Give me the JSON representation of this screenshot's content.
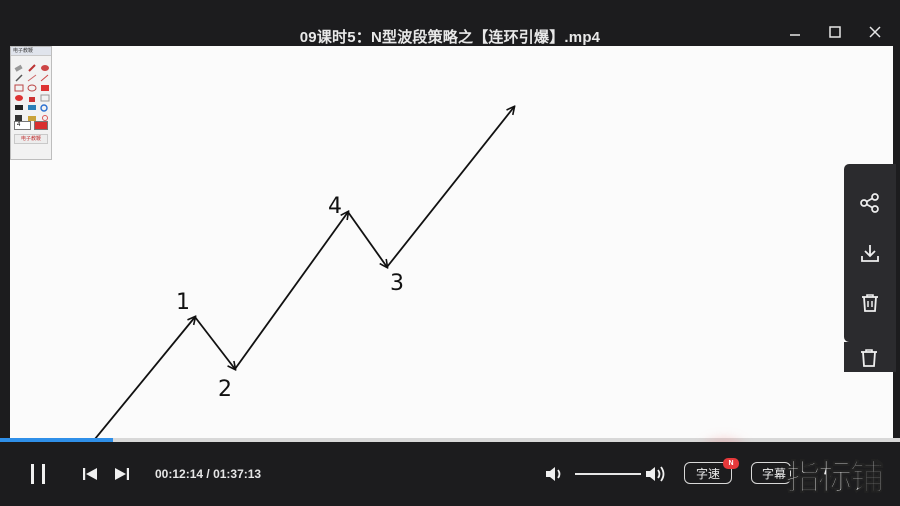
{
  "window": {
    "title": "09课时5：N型波段策略之【连环引爆】.mp4"
  },
  "drawing": {
    "labels": [
      "1",
      "2",
      "4",
      "3"
    ]
  },
  "palette": {
    "header": "电子教鞭",
    "size_value": "4",
    "footer": "电子教鞭"
  },
  "player": {
    "current_time": "00:12:14",
    "separator": " / ",
    "total_time": "01:37:13",
    "progress": 0.125,
    "volume": 0.78,
    "speed_label": "字速",
    "speed_badge": "N",
    "subtitle_label": "字幕"
  },
  "watermark": {
    "text": "指标铺"
  },
  "side_panel": {
    "items": [
      "share-icon",
      "download-icon",
      "delete-icon",
      "delete-icon"
    ]
  },
  "colors": {
    "accent": "#2f8fe8",
    "background": "#1c1c1e",
    "canvas": "#fbfbfb",
    "badge": "#e5393b"
  }
}
